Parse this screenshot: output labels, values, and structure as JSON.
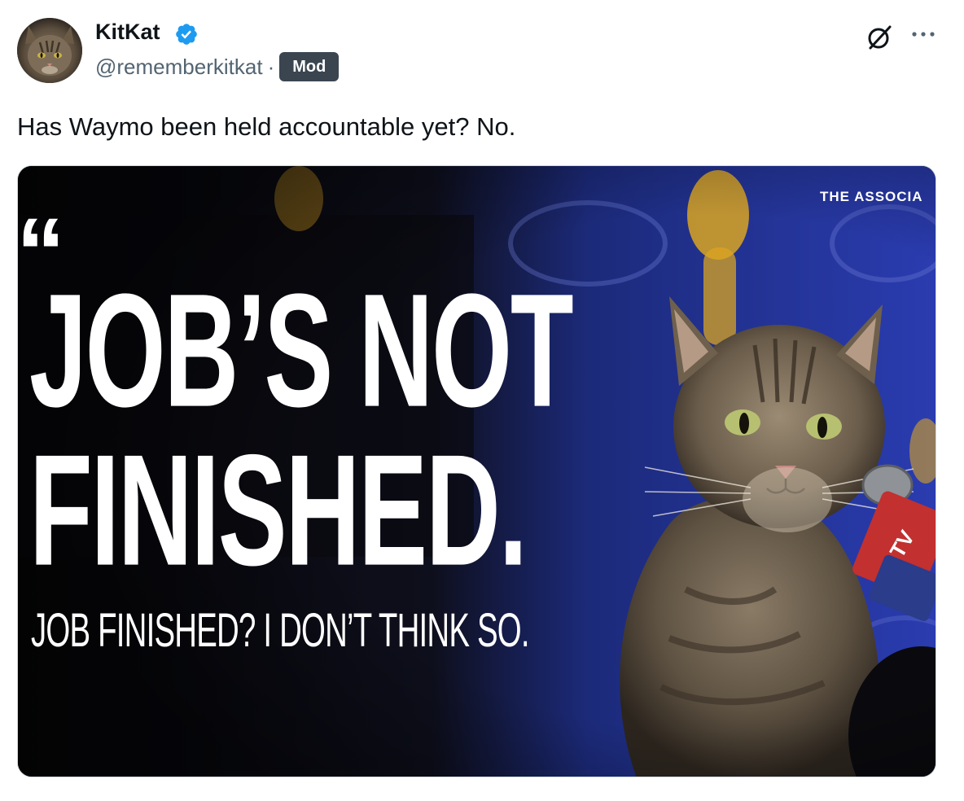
{
  "author": {
    "name": "KitKat",
    "handle": "@rememberkitkat",
    "separator": "·",
    "badge": "Mod",
    "verified": true,
    "avatar_icon": "cat-avatar"
  },
  "header_actions": {
    "grok_icon": "grok-icon",
    "more_icon": "more-options-icon"
  },
  "post": {
    "text": "Has Waymo been held accountable yet? No."
  },
  "media": {
    "quote_mark": "“",
    "headline_line1": "JOB’S NOT",
    "headline_line2": "FINISHED.",
    "subline": "JOB FINISHED? I DON’T THINK SO.",
    "corner_label": "THE ASSOCIA",
    "colors": {
      "backdrop_blue": "#2a3aa8",
      "trophy_gold": "#d9a422",
      "text_white": "#ffffff"
    }
  },
  "colors": {
    "verified_blue": "#1d9bf0",
    "secondary_text": "#536471",
    "primary_text": "#0f1419",
    "badge_bg": "#3a4550"
  }
}
